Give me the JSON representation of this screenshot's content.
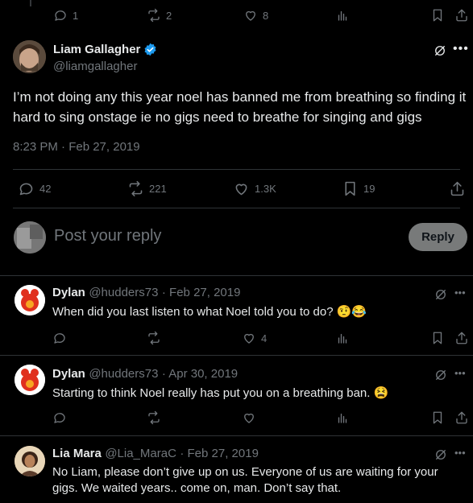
{
  "top_actions": {
    "replies": "1",
    "reposts": "2",
    "likes": "8"
  },
  "main": {
    "name": "Liam Gallagher",
    "handle": "@liamgallagher",
    "text": "I’m not doing any this year noel has banned me from breathing so finding it hard to sing onstage ie no gigs need to breathe for singing and gigs",
    "timestamp": "8:23 PM · Feb 27, 2019",
    "replies": "42",
    "reposts": "221",
    "likes": "1.3K",
    "bookmarks": "19"
  },
  "composer": {
    "placeholder": "Post your reply",
    "button": "Reply"
  },
  "replies": [
    {
      "name": "Dylan",
      "handle": "@hudders73",
      "date": "· Feb 27, 2019",
      "text": "When did you last listen to what Noel told you to do? 🤨😂",
      "likes": "4"
    },
    {
      "name": "Dylan",
      "handle": "@hudders73",
      "date": "· Apr 30, 2019",
      "text": "Starting to think Noel really has put you on a breathing ban. 😫",
      "likes": ""
    },
    {
      "name": "Lia Mara",
      "handle": "@Lia_MaraC",
      "date": "· Feb 27, 2019",
      "text": "No Liam, please don’t give up on us. Everyone of us are waiting for your gigs. We waited years.. come on, man. Don’t say that.",
      "likes": ""
    }
  ],
  "colors": {
    "accent": "#1d9bf0",
    "background": "#000000",
    "border": "#2f3336",
    "muted": "#71767b"
  }
}
